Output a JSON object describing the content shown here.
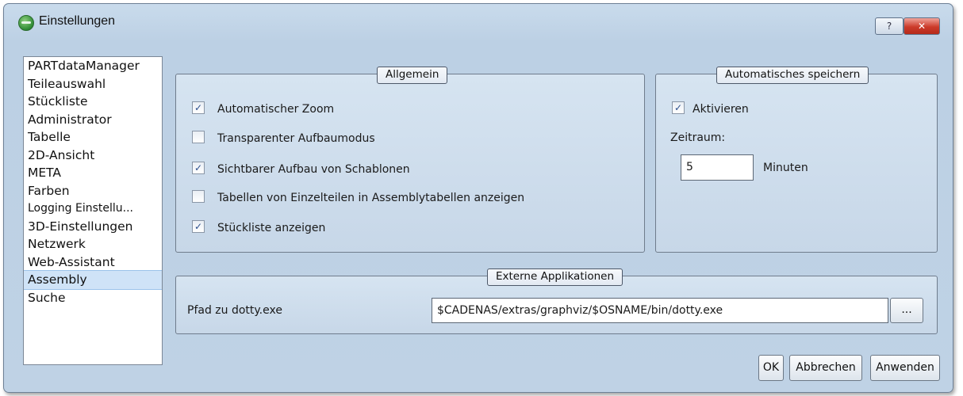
{
  "window": {
    "title": "Einstellungen",
    "help_label": "?",
    "close_label": "✕"
  },
  "nav": {
    "items": [
      {
        "label": "PARTdataManager"
      },
      {
        "label": "Teileauswahl"
      },
      {
        "label": "Stückliste"
      },
      {
        "label": "Administrator"
      },
      {
        "label": "Tabelle"
      },
      {
        "label": "2D-Ansicht"
      },
      {
        "label": "META"
      },
      {
        "label": "Farben"
      },
      {
        "label": "Logging Einstellu..."
      },
      {
        "label": "3D-Einstellungen"
      },
      {
        "label": "Netzwerk"
      },
      {
        "label": "Web-Assistant"
      },
      {
        "label": "Assembly"
      },
      {
        "label": "Suche"
      }
    ],
    "selected": "Assembly"
  },
  "allgemein": {
    "title": "Allgemein",
    "options": [
      {
        "label": "Automatischer Zoom",
        "checked": true
      },
      {
        "label": "Transparenter Aufbaumodus",
        "checked": false
      },
      {
        "label": "Sichtbarer Aufbau von Schablonen",
        "checked": true
      },
      {
        "label": "Tabellen von Einzelteilen in Assemblytabellen anzeigen",
        "checked": false
      },
      {
        "label": "Stückliste anzeigen",
        "checked": true
      }
    ]
  },
  "autosave": {
    "title": "Automatisches speichern",
    "activate_label": "Aktivieren",
    "activate_checked": true,
    "period_label": "Zeitraum:",
    "period_value": "5",
    "unit_label": "Minuten"
  },
  "external": {
    "title": "Externe Applikationen",
    "path_label": "Pfad zu dotty.exe",
    "path_value": "$CADENAS/extras/graphviz/$OSNAME/bin/dotty.exe",
    "browse_label": "..."
  },
  "buttons": {
    "ok": "OK",
    "cancel": "Abbrechen",
    "apply": "Anwenden"
  },
  "check_glyph": "✓"
}
